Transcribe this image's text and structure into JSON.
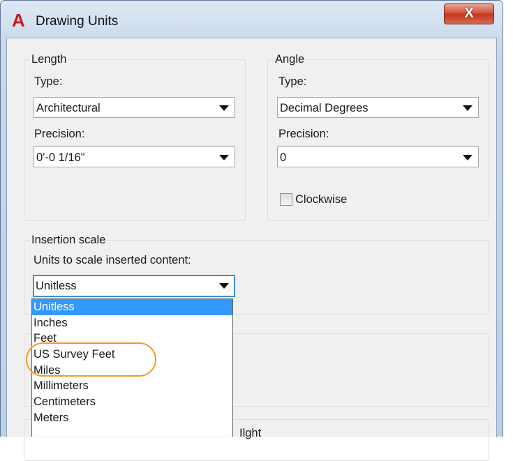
{
  "window": {
    "title": "Drawing Units",
    "close_glyph": "X",
    "app_icon": "autocad-a-icon",
    "app_icon_glyph": "A",
    "accent": "#d2161b"
  },
  "length": {
    "group_label": "Length",
    "type_label": "Type:",
    "type_value": "Architectural",
    "precision_label": "Precision:",
    "precision_value": "0'-0 1/16\""
  },
  "angle": {
    "group_label": "Angle",
    "type_label": "Type:",
    "type_value": "Decimal Degrees",
    "precision_label": "Precision:",
    "precision_value": "0",
    "clockwise_label": "Clockwise",
    "clockwise_checked": false
  },
  "insertion": {
    "group_label": "Insertion scale",
    "units_label": "Units to scale inserted content:",
    "selected_value": "Unitless",
    "options": [
      "Unitless",
      "Inches",
      "Feet",
      "US Survey Feet",
      "Miles",
      "Millimeters",
      "Centimeters",
      "Meters"
    ],
    "highlighted_option": "US Survey Feet",
    "highlight_color": "#f39a27"
  },
  "obscured_text": "Ilght"
}
